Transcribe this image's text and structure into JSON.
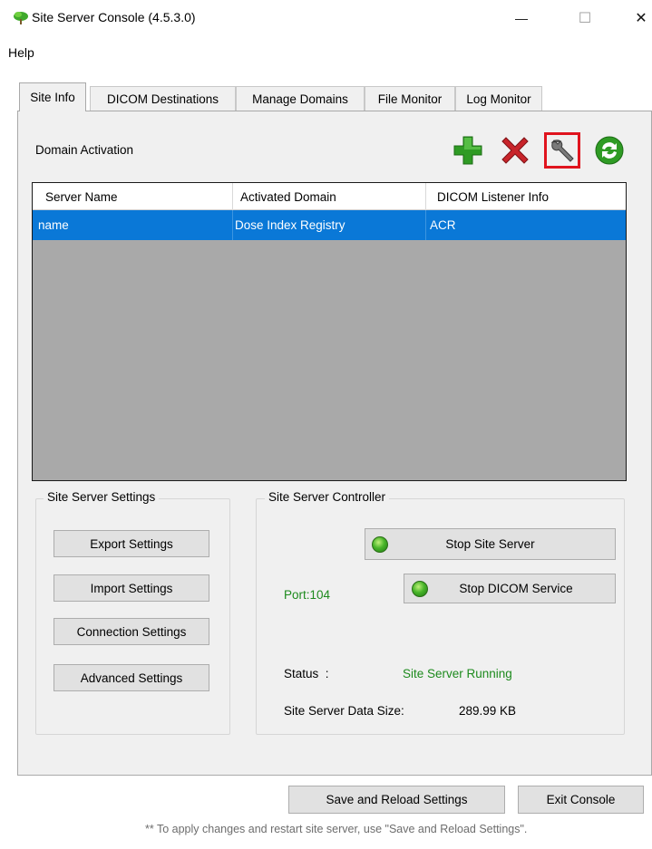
{
  "window": {
    "title": "Site Server Console (4.5.3.0)",
    "minimize": "—",
    "maximize": "☐",
    "close": "✕"
  },
  "menu": {
    "help": "Help"
  },
  "tabs": [
    {
      "label": "Site Info",
      "active": true
    },
    {
      "label": "DICOM Destinations"
    },
    {
      "label": "Manage Domains"
    },
    {
      "label": "File Monitor"
    },
    {
      "label": "Log Monitor"
    }
  ],
  "site_info": {
    "domain_activation_label": "Domain Activation",
    "toolbar": {
      "add_icon": "plus-icon",
      "delete_icon": "x-icon",
      "settings_icon": "wrench-icon",
      "refresh_icon": "refresh-icon"
    },
    "grid": {
      "columns": [
        "Server Name",
        "Activated Domain",
        "DICOM Listener Info"
      ],
      "rows": [
        [
          "name",
          "Dose Index Registry",
          "ACR"
        ]
      ]
    },
    "settings_group": {
      "title": "Site Server Settings",
      "export": "Export Settings",
      "import": "Import Settings",
      "connection": "Connection Settings",
      "advanced": "Advanced Settings"
    },
    "controller_group": {
      "title": "Site Server Controller",
      "stop_site_server": "Stop Site Server",
      "stop_dicom_service": "Stop DICOM Service",
      "port": "Port:104",
      "status_label": "Status  :",
      "status_value": "Site Server Running",
      "data_size_label": "Site Server Data Size:",
      "data_size_value": "289.99 KB"
    }
  },
  "footer": {
    "save_reload": "Save and Reload Settings",
    "exit": "Exit Console",
    "note": "** To apply changes and restart site server, use \"Save and Reload Settings\"."
  },
  "colors": {
    "selection": "#0a78d7",
    "status_green": "#1d8a1d",
    "highlight_red": "#e0141e"
  }
}
